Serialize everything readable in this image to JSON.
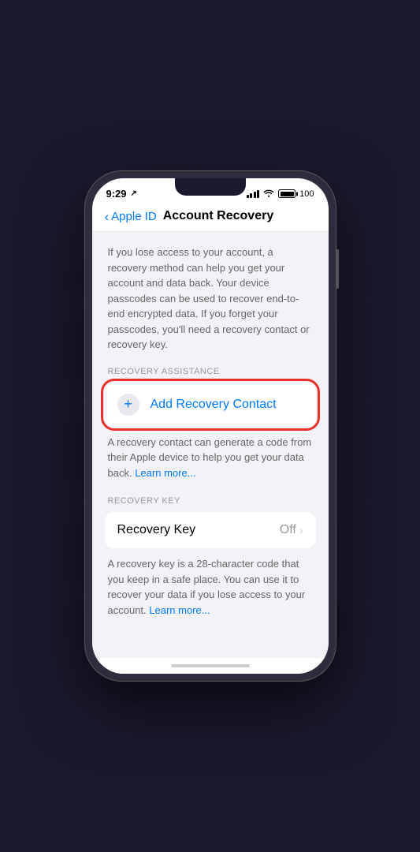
{
  "statusBar": {
    "time": "9:29",
    "locationArrow": "▲",
    "batteryPercent": "100"
  },
  "navBar": {
    "backLabel": "Apple ID",
    "title": "Account Recovery"
  },
  "content": {
    "descriptionText": "If you lose access to your account, a recovery method can help you get your account and data back. Your device passcodes can be used to recover end-to-end encrypted data. If you forget your passcodes, you'll need a recovery contact or recovery key.",
    "recoveryAssistance": {
      "sectionLabel": "RECOVERY ASSISTANCE",
      "addContactLabel": "Add Recovery Contact",
      "plusSymbol": "+",
      "helpText": "A recovery contact can generate a code from their Apple device to help you get your data back.",
      "learnMoreLink": "Learn more..."
    },
    "recoveryKey": {
      "sectionLabel": "RECOVERY KEY",
      "label": "Recovery Key",
      "status": "Off",
      "helpText": "A recovery key is a 28-character code that you keep in a safe place. You can use it to recover your data if you lose access to your account.",
      "learnMoreLink": "Learn more..."
    }
  }
}
